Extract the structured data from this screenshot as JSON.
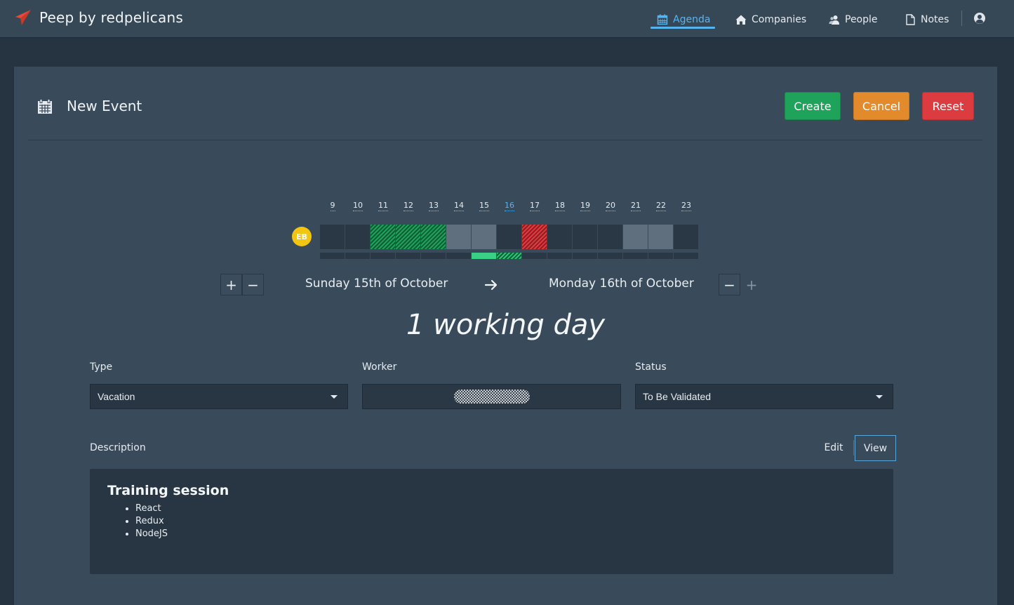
{
  "app": {
    "title": "Peep by redpelicans",
    "accent": "#e84b3a"
  },
  "nav": {
    "items": [
      {
        "label": "Agenda",
        "icon": "calendar-icon",
        "active": true
      },
      {
        "label": "Companies",
        "icon": "home-icon",
        "active": false
      },
      {
        "label": "People",
        "icon": "people-icon",
        "active": false
      },
      {
        "label": "Notes",
        "icon": "file-icon",
        "active": false
      }
    ],
    "user_icon": "user-circle-icon"
  },
  "page": {
    "title": "New Event",
    "icon": "calendar-icon",
    "buttons": {
      "create": "Create",
      "cancel": "Cancel",
      "reset": "Reset"
    },
    "colors": {
      "create": "#1fa25a",
      "cancel": "#e38a2c",
      "reset": "#dc3b3f"
    }
  },
  "timeline": {
    "avatar_initials": "EB",
    "days": [
      "9",
      "10",
      "11",
      "12",
      "13",
      "14",
      "15",
      "16",
      "17",
      "18",
      "19",
      "20",
      "21",
      "22",
      "23"
    ],
    "today": "16",
    "cell_states": [
      "empty",
      "empty",
      "green",
      "green",
      "green",
      "grey",
      "grey",
      "empty",
      "red",
      "empty",
      "empty",
      "empty",
      "grey",
      "grey",
      "empty"
    ],
    "selection_states": [
      "none",
      "none",
      "none",
      "none",
      "none",
      "none",
      "solid",
      "stripe",
      "none",
      "none",
      "none",
      "none",
      "none",
      "none",
      "none"
    ]
  },
  "range": {
    "start": "Sunday 15th of October",
    "end": "Monday 16th of October",
    "duration": "1 working day"
  },
  "form": {
    "type": {
      "label": "Type",
      "value": "Vacation"
    },
    "worker": {
      "label": "Worker"
    },
    "status": {
      "label": "Status",
      "value": "To Be Validated"
    }
  },
  "description": {
    "label": "Description",
    "tabs": {
      "edit": "Edit",
      "view": "View"
    },
    "heading": "Training session",
    "items": [
      "React",
      "Redux",
      "NodeJS"
    ]
  }
}
